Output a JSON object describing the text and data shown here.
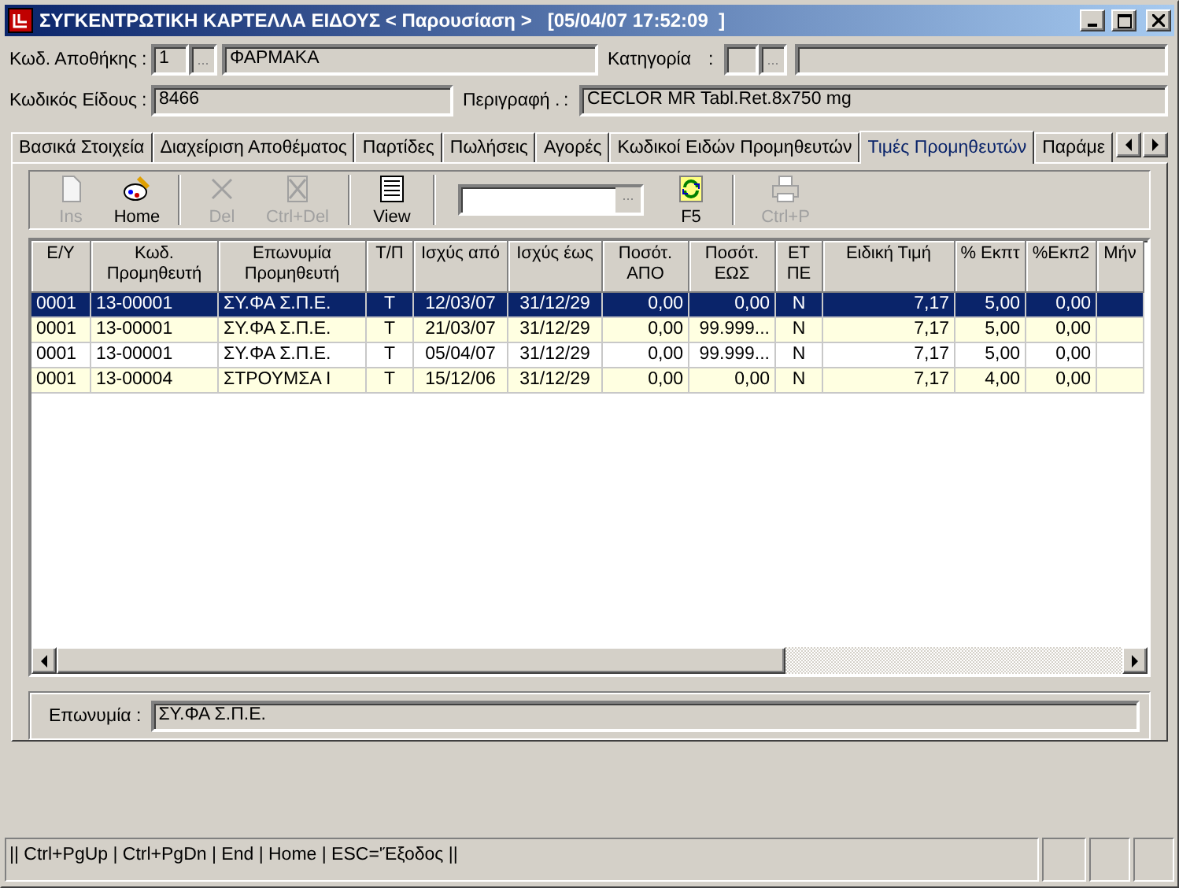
{
  "window": {
    "title": "ΣΥΓΚΕΝΤΡΩΤΙΚΗ ΚΑΡΤΕΛΛΑ ΕΙΔΟΥΣ < Παρουσίαση >   [05/04/07 17:52:09  ]"
  },
  "header": {
    "warehouse": {
      "label": "Κωδ. Αποθήκης",
      "colon": ":",
      "code": "1",
      "lookup": "...",
      "name": "ΦΑΡΜΑΚΑ"
    },
    "category": {
      "label": "Κατηγορία",
      "colon": ":",
      "lookup": "..."
    },
    "item_code": {
      "label": "Κωδικός Είδους",
      "colon": ":",
      "value": "8466"
    },
    "description": {
      "label": "Περιγραφή .",
      "colon": ":",
      "value": "CECLOR MR Tabl.Ret.8x750 mg"
    }
  },
  "tabs": [
    {
      "label": "Βασικά Στοιχεία",
      "selected": false
    },
    {
      "label": "Διαχείριση Αποθέματος",
      "selected": false
    },
    {
      "label": "Παρτίδες",
      "selected": false
    },
    {
      "label": "Πωλήσεις",
      "selected": false
    },
    {
      "label": "Αγορές",
      "selected": false
    },
    {
      "label": "Κωδικοί Ειδών Προμηθευτών",
      "selected": false
    },
    {
      "label": "Τιμές Προμηθευτών",
      "selected": true
    },
    {
      "label": "Παράμε",
      "selected": false
    }
  ],
  "toolbar": [
    {
      "kind": "button",
      "label": "Ins",
      "disabled": true
    },
    {
      "kind": "button",
      "label": "Home",
      "disabled": false
    },
    {
      "kind": "separator"
    },
    {
      "kind": "button",
      "label": "Del",
      "disabled": true
    },
    {
      "kind": "button",
      "label": "Ctrl+Del",
      "disabled": true
    },
    {
      "kind": "separator"
    },
    {
      "kind": "button",
      "label": "View",
      "disabled": false
    },
    {
      "kind": "separator"
    },
    {
      "kind": "combo",
      "lookup": "..."
    },
    {
      "kind": "button",
      "label": "F5",
      "disabled": false
    },
    {
      "kind": "separator"
    },
    {
      "kind": "button",
      "label": "Ctrl+P",
      "disabled": true
    }
  ],
  "table": {
    "columns": [
      {
        "label": "Ε/Υ",
        "kind": "text"
      },
      {
        "label": "Κωδ. Προμηθευτή",
        "kind": "text"
      },
      {
        "label": "Επωνυμία Προμηθευτή",
        "kind": "text"
      },
      {
        "label": "Τ/Π",
        "kind": "flag"
      },
      {
        "label": "Ισχύς από",
        "kind": "flag"
      },
      {
        "label": "Ισχύς έως",
        "kind": "flag"
      },
      {
        "label": "Ποσότ. ΑΠΟ",
        "kind": "number"
      },
      {
        "label": "Ποσότ. ΕΩΣ",
        "kind": "number"
      },
      {
        "label": "ΕΤ ΠΕ",
        "kind": "flag"
      },
      {
        "label": "Ειδική Τιμή",
        "kind": "number"
      },
      {
        "label": "% Εκπτ",
        "kind": "number"
      },
      {
        "label": "%Εκπ2",
        "kind": "number"
      },
      {
        "label": "Μήν",
        "kind": "number"
      }
    ],
    "rows": [
      {
        "selected": true,
        "cells": [
          "0001",
          "13-00001",
          "ΣΥ.ΦΑ Σ.Π.Ε.",
          "T",
          "12/03/07",
          "31/12/29",
          "0,00",
          "0,00",
          "N",
          "7,17",
          "5,00",
          "0,00",
          ""
        ]
      },
      {
        "selected": false,
        "cells": [
          "0001",
          "13-00001",
          "ΣΥ.ΦΑ Σ.Π.Ε.",
          "T",
          "21/03/07",
          "31/12/29",
          "0,00",
          "99.999...",
          "N",
          "7,17",
          "5,00",
          "0,00",
          ""
        ]
      },
      {
        "selected": false,
        "cells": [
          "0001",
          "13-00001",
          "ΣΥ.ΦΑ Σ.Π.Ε.",
          "T",
          "05/04/07",
          "31/12/29",
          "0,00",
          "99.999...",
          "N",
          "7,17",
          "5,00",
          "0,00",
          ""
        ]
      },
      {
        "selected": false,
        "cells": [
          "0001",
          "13-00004",
          "ΣΤΡΟΥΜΣΑ Ι",
          "T",
          "15/12/06",
          "31/12/29",
          "0,00",
          "0,00",
          "N",
          "7,17",
          "4,00",
          "0,00",
          ""
        ]
      }
    ]
  },
  "detail": {
    "label": "Επωνυμία :",
    "value": "ΣΥ.ΦΑ Σ.Π.Ε."
  },
  "status_bar": {
    "text": "|| Ctrl+PgUp | Ctrl+PgDn | End | Home | ESC='Έξοδος ||"
  }
}
